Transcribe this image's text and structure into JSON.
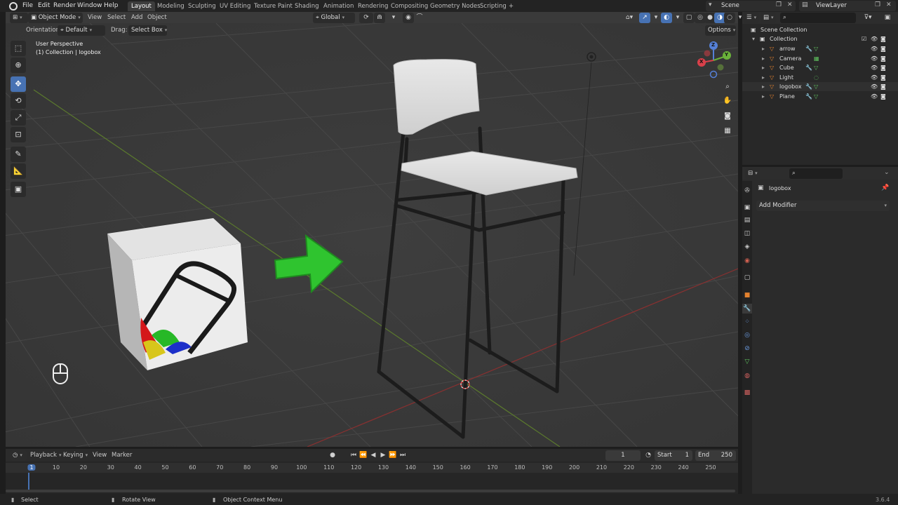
{
  "topbar": {
    "menus": [
      "File",
      "Edit",
      "Render",
      "Window",
      "Help"
    ],
    "workspaces": [
      "Layout",
      "Modeling",
      "Sculpting",
      "UV Editing",
      "Texture Paint",
      "Shading",
      "Animation",
      "Rendering",
      "Compositing",
      "Geometry Nodes",
      "Scripting"
    ],
    "active_workspace": "Layout",
    "add_tab": "+",
    "scene": "Scene",
    "view_layer": "ViewLayer"
  },
  "viewport_header": {
    "mode": "Object Mode",
    "menus": [
      "View",
      "Select",
      "Add",
      "Object"
    ],
    "transform_space": "Global",
    "orientation_label": "Orientation:",
    "orientation_value": "Default",
    "drag_label": "Drag:",
    "drag_value": "Select Box",
    "options": "Options"
  },
  "viewport": {
    "view_name": "User Perspective",
    "view_context": "(1) Collection | logobox",
    "gizmo": {
      "x": "X",
      "y": "Y",
      "z": "Z"
    }
  },
  "outliner": {
    "root": "Scene Collection",
    "collection": "Collection",
    "items": [
      {
        "name": "arrow",
        "icon": "mesh-icon",
        "color": "#e2812e"
      },
      {
        "name": "Camera",
        "icon": "camera-icon",
        "color": "#e2812e"
      },
      {
        "name": "Cube",
        "icon": "mesh-icon",
        "color": "#e2812e"
      },
      {
        "name": "Light",
        "icon": "light-icon",
        "color": "#e2812e"
      },
      {
        "name": "logobox",
        "icon": "mesh-icon",
        "color": "#e2812e",
        "selected": true
      },
      {
        "name": "Plane",
        "icon": "mesh-icon",
        "color": "#e2812e"
      }
    ]
  },
  "properties": {
    "object_name": "logobox",
    "add_modifier": "Add Modifier"
  },
  "timeline": {
    "menus": [
      "Playback",
      "Keying",
      "View",
      "Marker"
    ],
    "current_frame": "1",
    "start_label": "Start",
    "start_value": "1",
    "end_label": "End",
    "end_value": "250",
    "ticks": [
      "1",
      "10",
      "20",
      "30",
      "40",
      "50",
      "60",
      "70",
      "80",
      "90",
      "100",
      "110",
      "120",
      "130",
      "140",
      "150",
      "160",
      "170",
      "180",
      "190",
      "200",
      "210",
      "220",
      "230",
      "240",
      "250"
    ]
  },
  "statusbar": {
    "select": "Select",
    "rotate": "Rotate View",
    "context": "Object Context Menu",
    "version": "3.6.4"
  },
  "colors": {
    "accent": "#4772b3",
    "bg": "#1d1d1d",
    "viewport": "#3a3a3a",
    "arrow": "#2fc42f"
  }
}
